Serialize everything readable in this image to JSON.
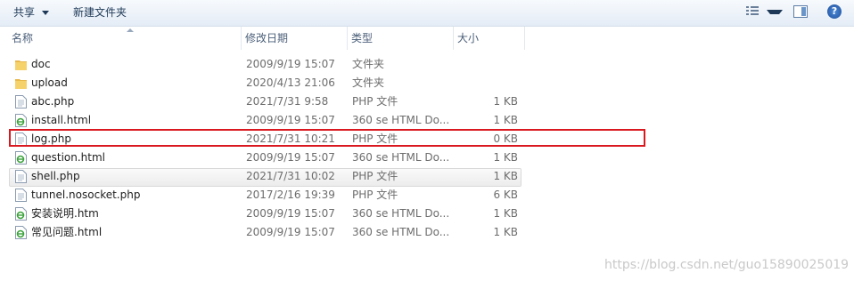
{
  "toolbar": {
    "share_label": "共享",
    "new_folder_label": "新建文件夹",
    "help_glyph": "?"
  },
  "columns": {
    "name": "名称",
    "date": "修改日期",
    "type": "类型",
    "size": "大小"
  },
  "files": [
    {
      "name": "doc",
      "date": "2009/9/19 15:07",
      "type": "文件夹",
      "size": "",
      "icon": "folder-icon"
    },
    {
      "name": "upload",
      "date": "2020/4/13 21:06",
      "type": "文件夹",
      "size": "",
      "icon": "folder-icon"
    },
    {
      "name": "abc.php",
      "date": "2021/7/31 9:58",
      "type": "PHP 文件",
      "size": "1 KB",
      "icon": "php-file-icon"
    },
    {
      "name": "install.html",
      "date": "2009/9/19 15:07",
      "type": "360 se HTML Do...",
      "size": "1 KB",
      "icon": "html-file-icon"
    },
    {
      "name": "log.php",
      "date": "2021/7/31 10:21",
      "type": "PHP 文件",
      "size": "0 KB",
      "icon": "php-file-icon"
    },
    {
      "name": "question.html",
      "date": "2009/9/19 15:07",
      "type": "360 se HTML Do...",
      "size": "1 KB",
      "icon": "html-file-icon"
    },
    {
      "name": "shell.php",
      "date": "2021/7/31 10:02",
      "type": "PHP 文件",
      "size": "1 KB",
      "icon": "php-file-icon"
    },
    {
      "name": "tunnel.nosocket.php",
      "date": "2017/2/16 19:39",
      "type": "PHP 文件",
      "size": "6 KB",
      "icon": "php-file-icon"
    },
    {
      "name": "安装说明.htm",
      "date": "2009/9/19 15:07",
      "type": "360 se HTML Do...",
      "size": "1 KB",
      "icon": "html-file-icon"
    },
    {
      "name": "常见问题.html",
      "date": "2009/9/19 15:07",
      "type": "360 se HTML Do...",
      "size": "1 KB",
      "icon": "html-file-icon"
    }
  ],
  "watermark": "https://blog.csdn.net/guo15890025019"
}
